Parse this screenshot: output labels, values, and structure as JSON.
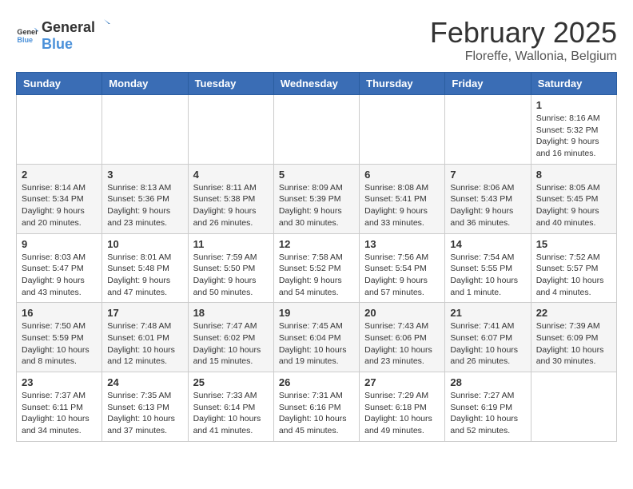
{
  "header": {
    "logo_general": "General",
    "logo_blue": "Blue",
    "title": "February 2025",
    "subtitle": "Floreffe, Wallonia, Belgium"
  },
  "weekdays": [
    "Sunday",
    "Monday",
    "Tuesday",
    "Wednesday",
    "Thursday",
    "Friday",
    "Saturday"
  ],
  "weeks": [
    [
      {
        "day": "",
        "info": ""
      },
      {
        "day": "",
        "info": ""
      },
      {
        "day": "",
        "info": ""
      },
      {
        "day": "",
        "info": ""
      },
      {
        "day": "",
        "info": ""
      },
      {
        "day": "",
        "info": ""
      },
      {
        "day": "1",
        "info": "Sunrise: 8:16 AM\nSunset: 5:32 PM\nDaylight: 9 hours and 16 minutes."
      }
    ],
    [
      {
        "day": "2",
        "info": "Sunrise: 8:14 AM\nSunset: 5:34 PM\nDaylight: 9 hours and 20 minutes."
      },
      {
        "day": "3",
        "info": "Sunrise: 8:13 AM\nSunset: 5:36 PM\nDaylight: 9 hours and 23 minutes."
      },
      {
        "day": "4",
        "info": "Sunrise: 8:11 AM\nSunset: 5:38 PM\nDaylight: 9 hours and 26 minutes."
      },
      {
        "day": "5",
        "info": "Sunrise: 8:09 AM\nSunset: 5:39 PM\nDaylight: 9 hours and 30 minutes."
      },
      {
        "day": "6",
        "info": "Sunrise: 8:08 AM\nSunset: 5:41 PM\nDaylight: 9 hours and 33 minutes."
      },
      {
        "day": "7",
        "info": "Sunrise: 8:06 AM\nSunset: 5:43 PM\nDaylight: 9 hours and 36 minutes."
      },
      {
        "day": "8",
        "info": "Sunrise: 8:05 AM\nSunset: 5:45 PM\nDaylight: 9 hours and 40 minutes."
      }
    ],
    [
      {
        "day": "9",
        "info": "Sunrise: 8:03 AM\nSunset: 5:47 PM\nDaylight: 9 hours and 43 minutes."
      },
      {
        "day": "10",
        "info": "Sunrise: 8:01 AM\nSunset: 5:48 PM\nDaylight: 9 hours and 47 minutes."
      },
      {
        "day": "11",
        "info": "Sunrise: 7:59 AM\nSunset: 5:50 PM\nDaylight: 9 hours and 50 minutes."
      },
      {
        "day": "12",
        "info": "Sunrise: 7:58 AM\nSunset: 5:52 PM\nDaylight: 9 hours and 54 minutes."
      },
      {
        "day": "13",
        "info": "Sunrise: 7:56 AM\nSunset: 5:54 PM\nDaylight: 9 hours and 57 minutes."
      },
      {
        "day": "14",
        "info": "Sunrise: 7:54 AM\nSunset: 5:55 PM\nDaylight: 10 hours and 1 minute."
      },
      {
        "day": "15",
        "info": "Sunrise: 7:52 AM\nSunset: 5:57 PM\nDaylight: 10 hours and 4 minutes."
      }
    ],
    [
      {
        "day": "16",
        "info": "Sunrise: 7:50 AM\nSunset: 5:59 PM\nDaylight: 10 hours and 8 minutes."
      },
      {
        "day": "17",
        "info": "Sunrise: 7:48 AM\nSunset: 6:01 PM\nDaylight: 10 hours and 12 minutes."
      },
      {
        "day": "18",
        "info": "Sunrise: 7:47 AM\nSunset: 6:02 PM\nDaylight: 10 hours and 15 minutes."
      },
      {
        "day": "19",
        "info": "Sunrise: 7:45 AM\nSunset: 6:04 PM\nDaylight: 10 hours and 19 minutes."
      },
      {
        "day": "20",
        "info": "Sunrise: 7:43 AM\nSunset: 6:06 PM\nDaylight: 10 hours and 23 minutes."
      },
      {
        "day": "21",
        "info": "Sunrise: 7:41 AM\nSunset: 6:07 PM\nDaylight: 10 hours and 26 minutes."
      },
      {
        "day": "22",
        "info": "Sunrise: 7:39 AM\nSunset: 6:09 PM\nDaylight: 10 hours and 30 minutes."
      }
    ],
    [
      {
        "day": "23",
        "info": "Sunrise: 7:37 AM\nSunset: 6:11 PM\nDaylight: 10 hours and 34 minutes."
      },
      {
        "day": "24",
        "info": "Sunrise: 7:35 AM\nSunset: 6:13 PM\nDaylight: 10 hours and 37 minutes."
      },
      {
        "day": "25",
        "info": "Sunrise: 7:33 AM\nSunset: 6:14 PM\nDaylight: 10 hours and 41 minutes."
      },
      {
        "day": "26",
        "info": "Sunrise: 7:31 AM\nSunset: 6:16 PM\nDaylight: 10 hours and 45 minutes."
      },
      {
        "day": "27",
        "info": "Sunrise: 7:29 AM\nSunset: 6:18 PM\nDaylight: 10 hours and 49 minutes."
      },
      {
        "day": "28",
        "info": "Sunrise: 7:27 AM\nSunset: 6:19 PM\nDaylight: 10 hours and 52 minutes."
      },
      {
        "day": "",
        "info": ""
      }
    ]
  ]
}
